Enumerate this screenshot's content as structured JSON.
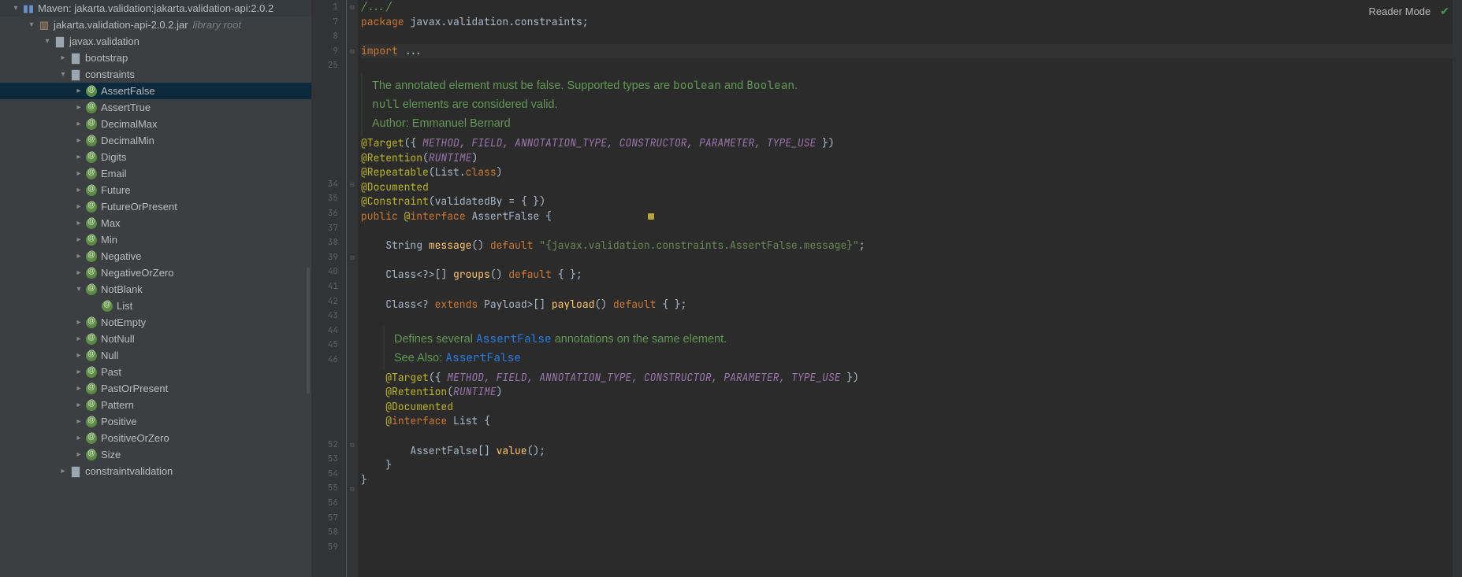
{
  "readerMode": "Reader Mode",
  "tree": {
    "root": {
      "label": "Maven: jakarta.validation:jakarta.validation-api:2.0.2"
    },
    "jar": {
      "label": "jakarta.validation-api-2.0.2.jar",
      "suffix": "library root"
    },
    "pkg": {
      "label": "javax.validation"
    },
    "folders": {
      "bootstrap": "bootstrap",
      "constraints": "constraints",
      "constraintvalidation": "constraintvalidation"
    },
    "constraints": [
      "AssertFalse",
      "AssertTrue",
      "DecimalMax",
      "DecimalMin",
      "Digits",
      "Email",
      "Future",
      "FutureOrPresent",
      "Max",
      "Min",
      "Negative",
      "NegativeOrZero",
      "NotBlank",
      "NotEmpty",
      "NotNull",
      "Null",
      "Past",
      "PastOrPresent",
      "Pattern",
      "Positive",
      "PositiveOrZero",
      "Size"
    ],
    "notblankChild": "List"
  },
  "gutter": [
    "1",
    "7",
    "8",
    "9",
    "25",
    "",
    "",
    "",
    "",
    "34",
    "35",
    "36",
    "37",
    "38",
    "39",
    "40",
    "41",
    "42",
    "43",
    "44",
    "45",
    "46",
    "",
    "",
    "",
    "52",
    "53",
    "54",
    "55",
    "56",
    "57",
    "58",
    "59"
  ],
  "code": {
    "l1": "/.../",
    "pkg_kw": "package ",
    "pkg_id": "javax.validation.constraints",
    "semi": ";",
    "import_kw": "import ",
    "import_rest": "...",
    "doc1_a": "The annotated element must be false. Supported types are ",
    "doc1_b": "boolean",
    "doc1_c": " and ",
    "doc1_d": "Boolean",
    "doc1_e": ".",
    "doc2_a": "null",
    "doc2_b": " elements are considered valid.",
    "doc3": "Author: Emmanuel Bernard",
    "target1_a": "@Target",
    "target1_b": "({ ",
    "target1_items": "METHOD, FIELD, ANNOTATION_TYPE, CONSTRUCTOR, PARAMETER, TYPE_USE",
    "target1_c": " })",
    "retention_a": "@Retention",
    "retention_b": "(",
    "retention_c": "RUNTIME",
    "retention_d": ")",
    "repeatable_a": "@Repeatable",
    "repeatable_b": "(List.",
    "repeatable_c": "class",
    "repeatable_d": ")",
    "documented": "@Documented",
    "constraint_a": "@Constraint",
    "constraint_b": "(validatedBy = { })",
    "public_kw": "public ",
    "at": "@",
    "interface_kw": "interface ",
    "classname": "AssertFalse",
    "brace_open": " {",
    "msg_a": "    String ",
    "msg_b": "message",
    "msg_c": "() ",
    "default_kw": "default",
    "msg_d": " ",
    "msg_str": "\"{javax.validation.constraints.AssertFalse.message}\"",
    "msg_e": ";",
    "groups_a": "    Class<?>[] ",
    "groups_b": "groups",
    "groups_c": "() ",
    "groups_d": " { };",
    "payload_a": "    Class<? ",
    "extends_kw": "extends",
    "payload_b": " Payload>[] ",
    "payload_c": "payload",
    "payload_d": "() ",
    "payload_e": " { };",
    "doc4_a": "Defines several ",
    "doc4_b": "AssertFalse",
    "doc4_c": " annotations on the same element.",
    "doc5_a": "See Also: ",
    "doc5_b": "AssertFalse",
    "target2_a": "    @Target",
    "target2_b": "({ ",
    "target2_items": "METHOD, FIELD, ANNOTATION_TYPE, CONSTRUCTOR, PARAMETER, TYPE_USE",
    "target2_c": " })",
    "ret2_a": "    @Retention",
    "doc2": "    @Documented",
    "list_a": "    @",
    "list_b": "interface ",
    "list_c": "List",
    "list_d": " {",
    "value_a": "        AssertFalse[] ",
    "value_b": "value",
    "value_c": "();",
    "close1": "    }",
    "close2": "}"
  }
}
